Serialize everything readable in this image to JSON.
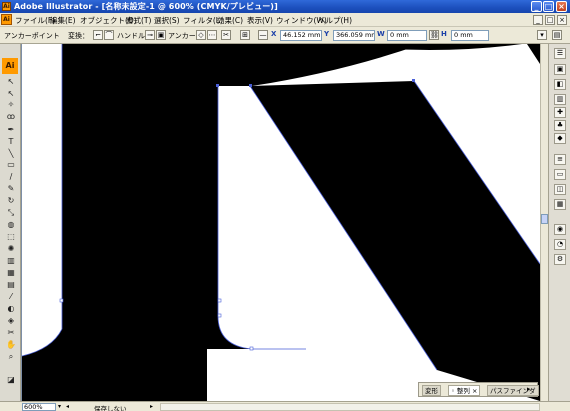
{
  "window": {
    "title": "Adobe Illustrator - [名称未設定-1 @ 600% (CMYK/プレビュー)]",
    "app_icon": "Ai",
    "buttons": {
      "minimize": "_",
      "maximize": "□",
      "close": "×"
    }
  },
  "menubar": {
    "logo": "Ai",
    "items": [
      "ファイル(F)",
      "編集(E)",
      "オブジェクト(O)",
      "書式(T)",
      "選択(S)",
      "フィルタ(L)",
      "効果(C)",
      "表示(V)",
      "ウィンドウ(W)",
      "ヘルプ(H)"
    ],
    "mini_buttons": [
      "_",
      "□",
      "×"
    ]
  },
  "controlbar": {
    "label": "アンカーポイント",
    "convert_label": "変換：",
    "handle_label": "ハンドル：",
    "anchor_label": "アンカー：",
    "x_label": "X",
    "x_value": "46.152 mm",
    "y_label": "Y",
    "y_value": "366.059 mm",
    "w_label": "W",
    "w_value": "0 mm",
    "h_label": "H",
    "h_value": "0 mm"
  },
  "toolpanel": {
    "badge": "Ai",
    "tools": [
      {
        "name": "selection-tool",
        "glyph": "↖"
      },
      {
        "name": "direct-selection-tool",
        "glyph": "↖"
      },
      {
        "name": "magic-wand-tool",
        "glyph": "✧"
      },
      {
        "name": "lasso-tool",
        "glyph": "ꝏ"
      },
      {
        "name": "pen-tool",
        "glyph": "✒"
      },
      {
        "name": "type-tool",
        "glyph": "T"
      },
      {
        "name": "line-tool",
        "glyph": "╲"
      },
      {
        "name": "rectangle-tool",
        "glyph": "▭"
      },
      {
        "name": "paintbrush-tool",
        "glyph": "∕"
      },
      {
        "name": "pencil-tool",
        "glyph": "✎"
      },
      {
        "name": "rotate-tool",
        "glyph": "↻"
      },
      {
        "name": "scale-tool",
        "glyph": "⤡"
      },
      {
        "name": "warp-tool",
        "glyph": "◍"
      },
      {
        "name": "free-transform-tool",
        "glyph": "⬚"
      },
      {
        "name": "symbol-sprayer-tool",
        "glyph": "✺"
      },
      {
        "name": "graph-tool",
        "glyph": "▥"
      },
      {
        "name": "mesh-tool",
        "glyph": "▦"
      },
      {
        "name": "gradient-tool",
        "glyph": "▤"
      },
      {
        "name": "eyedropper-tool",
        "glyph": "⁄"
      },
      {
        "name": "blend-tool",
        "glyph": "◐"
      },
      {
        "name": "live-paint-tool",
        "glyph": "◈"
      },
      {
        "name": "scissors-tool",
        "glyph": "✂"
      },
      {
        "name": "hand-tool",
        "glyph": "✋"
      },
      {
        "name": "zoom-tool",
        "glyph": "⌕"
      },
      {
        "name": "fill-stroke-swatch",
        "glyph": "◪"
      }
    ]
  },
  "dock": {
    "icons": [
      "☰",
      "▣",
      "◧",
      "▥",
      "✚",
      "♣",
      "◆",
      "≡",
      "▭",
      "◫",
      "▦",
      "◉",
      "◔",
      "⚙"
    ]
  },
  "panels": {
    "tabs": [
      "変形",
      "整列",
      "パスファインダ"
    ],
    "active_tab": "整列"
  },
  "status": {
    "zoom": "600%",
    "save_status": "保存しない"
  },
  "colors": {
    "accent": "#ff9a00",
    "selection_path": "#4a5fd8",
    "artwork": "#000000"
  }
}
